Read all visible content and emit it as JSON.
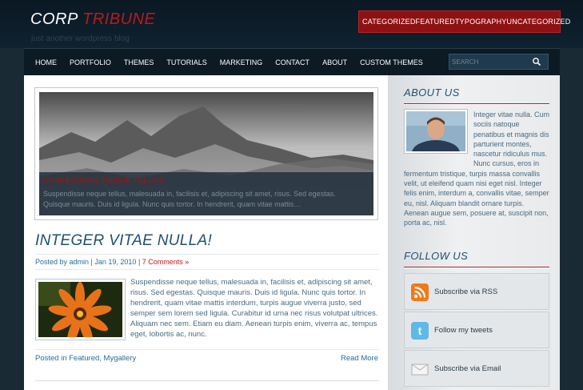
{
  "site": {
    "logo_main": "CORP",
    "logo_accent": "TRIBUNE",
    "tagline": "just another wordpress blog"
  },
  "top_categories": [
    "CATEGORIZED",
    "FEATURED",
    "TYPOGRAPHY",
    "UNCATEGORIZED"
  ],
  "nav": {
    "items": [
      "HOME",
      "PORTFOLIO",
      "THEMES",
      "TUTORIALS",
      "MARKETING",
      "CONTACT",
      "ABOUT",
      "CUSTOM THEMES"
    ],
    "search_placeholder": "SEARCH"
  },
  "slider": {
    "title": "SUSPENDISSE NEQUE TELLUS",
    "text": "Suspendisse neque tellus, malesuada in, facilisis et, adipiscing sit amet, risus. Sed egestas. Quisque mauris. Duis id ligula. Nunc quis tortor. In hendrerit, quam vitae mattis…"
  },
  "post": {
    "title": "INTEGER VITAE NULLA!",
    "meta_author": "Posted by admin",
    "meta_sep": " | ",
    "meta_date": "Jan 19, 2010",
    "meta_sep2": " | ",
    "meta_comments": "7 Comments »",
    "body": "Suspendisse neque tellus, malesuada in, facilisis et, adipiscing sit amet, risus. Sed egestas. Quisque mauris. Duis id ligula. Nunc quis tortor. In hendrerit, quam vitae mattis interdum, turpis augue viverra justo, sed semper sem lorem sed ligula. Curabitur id urna nec risus volutpat ultrices. Aliquam nec sem. Etiam eu diam. Aenean turpis enim, viverra ac, tempus eget, lobortis ac, nunc.",
    "footer_cats": "Posted in Featured, Mygallery",
    "read_more": "Read More"
  },
  "sidebar": {
    "about_title": "ABOUT US",
    "about_text": "Integer vitae nulla. Cum sociis natoque penatibus et magnis dis parturient montes, nascetur ridiculus mus. Nunc cursus, eros in fermentum tristique, turpis massa convallis velit, ut eleifend quam nisi eget nisl. Integer felis enim, interdum a, convallis vitae, semper eu, nisl. Aliquam blandit ornare turpis. Aenean augue sem, posuere at, suscipit non, porta ac, nisl.",
    "follow_title": "FOLLOW US",
    "follow_items": [
      {
        "label": "Subscribe via RSS",
        "icon": "rss-icon"
      },
      {
        "label": "Follow my tweets",
        "icon": "twitter-icon"
      },
      {
        "label": "Subscribe via Email",
        "icon": "email-icon"
      }
    ]
  },
  "colors": {
    "accent_red": "#b51b20",
    "title_blue": "#1e4f70",
    "header_dark": "#0a1822"
  }
}
